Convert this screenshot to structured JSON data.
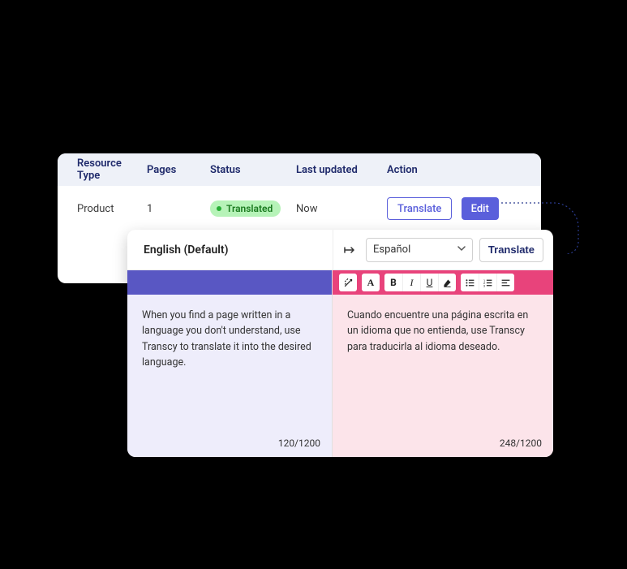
{
  "table": {
    "headers": {
      "resource": "Resource Type",
      "pages": "Pages",
      "status": "Status",
      "updated": "Last updated",
      "action": "Action"
    },
    "row": {
      "resource": "Product",
      "pages": "1",
      "status_label": "Translated",
      "updated": "Now",
      "translate_label": "Translate",
      "edit_label": "Edit"
    }
  },
  "editor": {
    "source_label": "English (Default)",
    "target_language": "Español",
    "translate_button": "Translate",
    "source_text": "When you find a page written in a language you don't understand, use Transcy to translate it into the desired language.",
    "target_text": "Cuando encuentre una página escrita en un idioma que no entienda, use Transcy para traducirla al idioma deseado.",
    "source_counter": "120/1200",
    "target_counter": "248/1200",
    "tools": {
      "magic": "magic-icon",
      "font": "A",
      "bold": "B",
      "italic": "I",
      "underline": "U",
      "eraser": "eraser-icon",
      "list_bullet": "bullet-list-icon",
      "list_number": "number-list-icon",
      "align": "align-icon"
    }
  }
}
